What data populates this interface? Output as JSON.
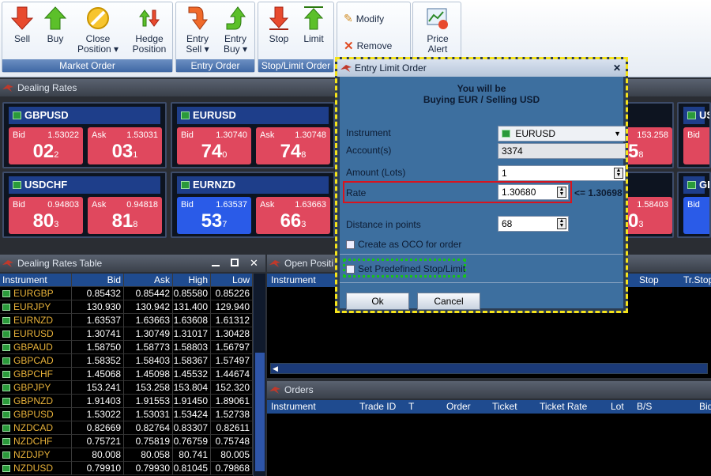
{
  "ribbon": {
    "groups": [
      {
        "title": "Market Order",
        "buttons": [
          "Sell",
          "Buy",
          "Close\nPosition ▾",
          "Hedge\nPosition"
        ]
      },
      {
        "title": "Entry Order",
        "buttons": [
          "Entry\nSell ▾",
          "Entry\nBuy ▾"
        ]
      },
      {
        "title": "Stop/Limit Order",
        "buttons": [
          "Stop",
          "Limit"
        ]
      },
      {
        "title": "",
        "buttons": [
          "Modify",
          "Remove"
        ]
      },
      {
        "title": "",
        "buttons": [
          "Price\nAlert"
        ]
      }
    ],
    "sell": "Sell",
    "buy": "Buy",
    "close": "Close",
    "close2": "Position ▾",
    "hedge": "Hedge",
    "hedge2": "Position",
    "entry_sell": "Entry",
    "entry_sell2": "Sell ▾",
    "entry_buy": "Entry",
    "entry_buy2": "Buy ▾",
    "stop": "Stop",
    "limit": "Limit",
    "modify": "Modify",
    "remove": "Remove",
    "alert": "Price",
    "alert2": "Alert",
    "market_title": "Market Order",
    "entry_title": "Entry Order",
    "stoplimit_title": "Stop/Limit Order"
  },
  "dealing_rates": {
    "title": "Dealing Rates",
    "tiles": [
      {
        "pair": "GBPUSD",
        "bid_price": "1.53022",
        "bid_big": "02",
        "bid_pip": "2",
        "ask_price": "1.53031",
        "ask_big": "03",
        "ask_pip": "1"
      },
      {
        "pair": "EURUSD",
        "bid_price": "1.30740",
        "bid_big": "74",
        "bid_pip": "0",
        "ask_price": "1.30748",
        "ask_big": "74",
        "ask_pip": "8"
      },
      {
        "pair": "USDCHF",
        "bid_price": "0.94803",
        "bid_big": "80",
        "bid_pip": "3",
        "ask_price": "0.94818",
        "ask_big": "81",
        "ask_pip": "8"
      },
      {
        "pair": "EURNZD",
        "bid_price": "1.63537",
        "bid_big": "53",
        "bid_pip": "7",
        "ask_price": "1.63663",
        "ask_big": "66",
        "ask_pip": "3"
      }
    ],
    "partial": {
      "ask_price": "153.258",
      "ask_big": "5",
      "ask_pip": "8",
      "ask2_price": "1.58403",
      "ask2_big": "0",
      "ask2_pip": "3",
      "pair_a": "US",
      "pair_b": "GB",
      "bid": "Bid"
    }
  },
  "dealing_table": {
    "title": "Dealing Rates Table",
    "columns": [
      "Instrument",
      "Bid",
      "Ask",
      "High",
      "Low"
    ],
    "rows": [
      [
        "EURGBP",
        "0.85432",
        "0.85442",
        "0.85580",
        "0.85226"
      ],
      [
        "EURJPY",
        "130.930",
        "130.942",
        "131.400",
        "129.940"
      ],
      [
        "EURNZD",
        "1.63537",
        "1.63663",
        "1.63608",
        "1.61312"
      ],
      [
        "EURUSD",
        "1.30741",
        "1.30749",
        "1.31017",
        "1.30428"
      ],
      [
        "GBPAUD",
        "1.58750",
        "1.58773",
        "1.58803",
        "1.56797"
      ],
      [
        "GBPCAD",
        "1.58352",
        "1.58403",
        "1.58367",
        "1.57497"
      ],
      [
        "GBPCHF",
        "1.45068",
        "1.45098",
        "1.45532",
        "1.44674"
      ],
      [
        "GBPJPY",
        "153.241",
        "153.258",
        "153.804",
        "152.320"
      ],
      [
        "GBPNZD",
        "1.91403",
        "1.91553",
        "1.91450",
        "1.89061"
      ],
      [
        "GBPUSD",
        "1.53022",
        "1.53031",
        "1.53424",
        "1.52738"
      ],
      [
        "NZDCAD",
        "0.82669",
        "0.82764",
        "0.83307",
        "0.82611"
      ],
      [
        "NZDCHF",
        "0.75721",
        "0.75819",
        "0.76759",
        "0.75748"
      ],
      [
        "NZDJPY",
        "80.008",
        "80.058",
        "80.741",
        "80.005"
      ],
      [
        "NZDUSD",
        "0.79910",
        "0.79930",
        "0.81045",
        "0.79868"
      ]
    ]
  },
  "open_positions": {
    "title": "Open Positi",
    "columns": [
      "Instrument",
      "Stop",
      "Tr.Stop"
    ]
  },
  "orders": {
    "title": "Orders",
    "columns": [
      "Instrument",
      "Trade ID",
      "T",
      "Order",
      "Ticket",
      "Ticket Rate",
      "Lot",
      "B/S",
      "Bid"
    ]
  },
  "dialog": {
    "title": "Entry Limit Order",
    "close": "✕",
    "you_will_be": "You will be",
    "action": "Buying EUR / Selling USD",
    "instrument_label": "Instrument",
    "instrument_value": "EURUSD",
    "account_label": "Account(s)",
    "account_value": "3374",
    "amount_label": "Amount (Lots)",
    "amount_value": "1",
    "rate_label": "Rate",
    "rate_value": "1.30680",
    "rate_hint": "<= 1.30698",
    "distance_label": "Distance in points",
    "distance_value": "68",
    "oco_label": "Create as OCO for order",
    "predef_label": "Set Predefined Stop/Limit",
    "ok": "Ok",
    "cancel": "Cancel"
  },
  "colors": {
    "bid_red": "#e0485e",
    "bid_blue": "#2a5be8",
    "header_blue": "#1f4b8f",
    "dialog_border": "#f5e31a"
  }
}
